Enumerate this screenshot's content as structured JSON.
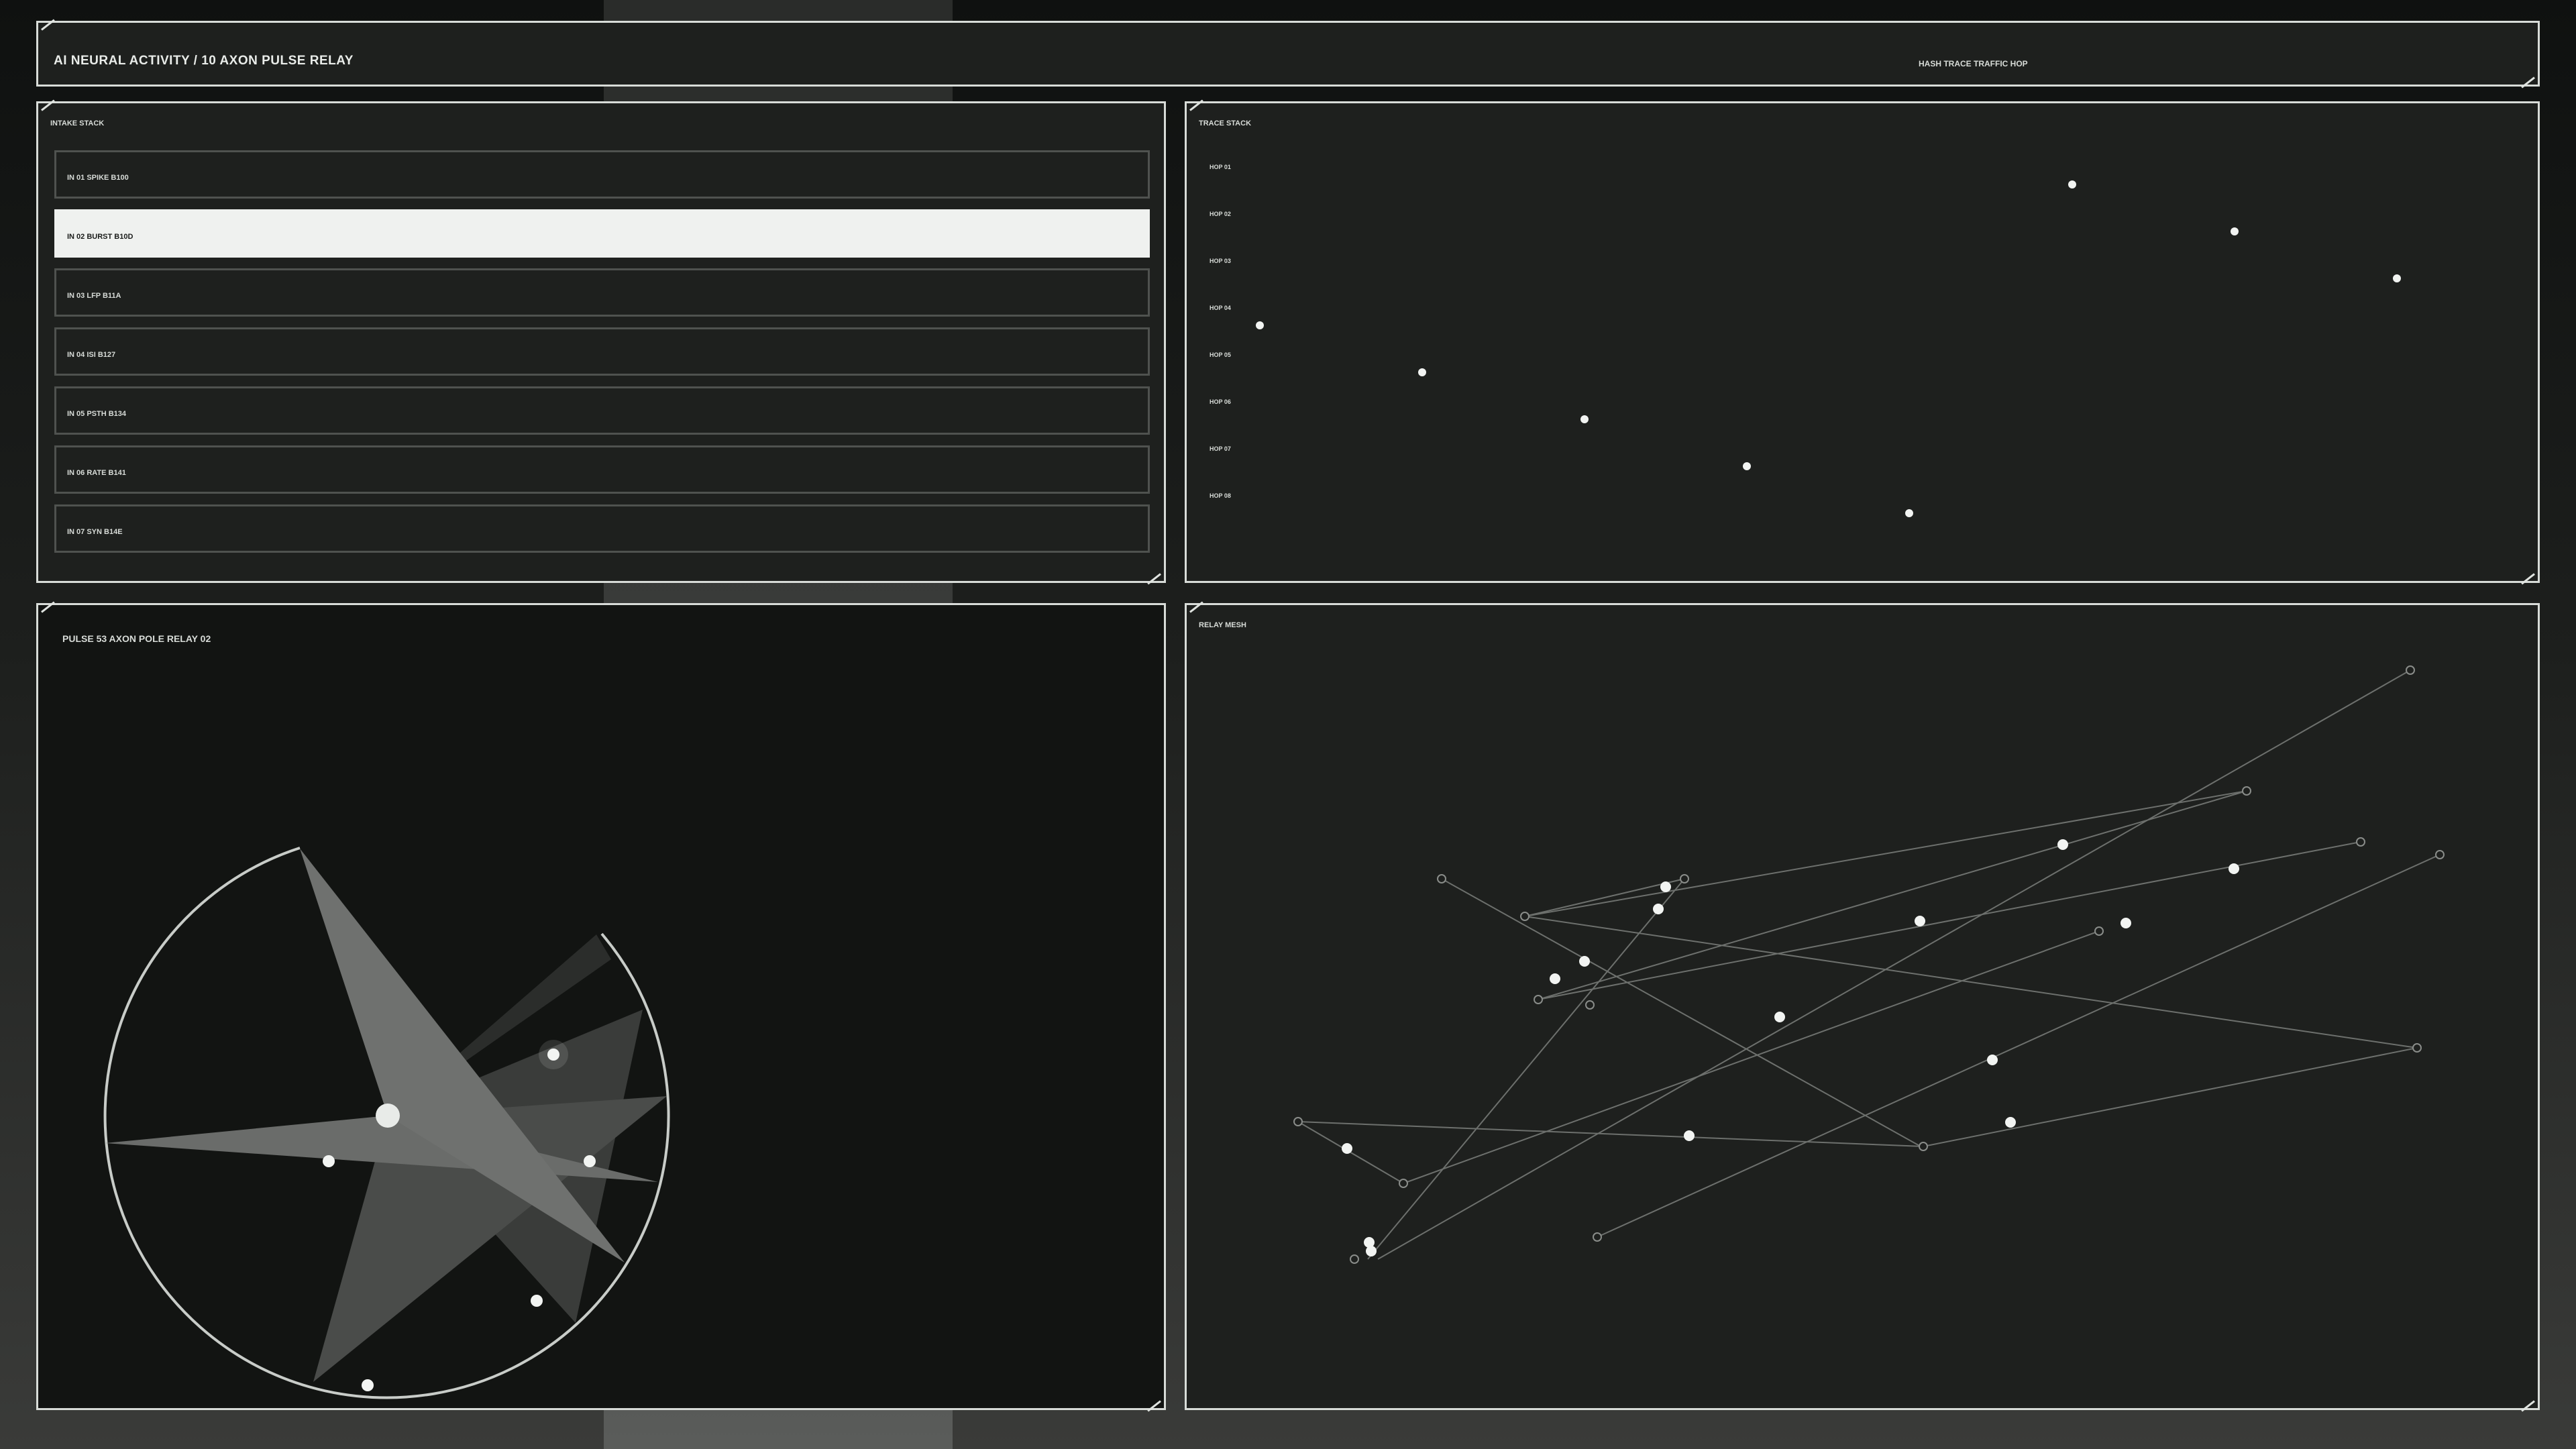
{
  "header": {
    "title": "AI NEURAL ACTIVITY  /  10  AXON PULSE RELAY",
    "right_labels": "HASH  TRACE  TRAFFIC  HOP"
  },
  "intake": {
    "title": "INTAKE STACK",
    "rows": [
      {
        "label": "IN 01  SPIKE  B100",
        "active": false
      },
      {
        "label": "IN 02  BURST  B10D",
        "active": true
      },
      {
        "label": "IN 03  LFP  B11A",
        "active": false
      },
      {
        "label": "IN 04  ISI  B127",
        "active": false
      },
      {
        "label": "IN 05  PSTH  B134",
        "active": false
      },
      {
        "label": "IN 06  RATE  B141",
        "active": false
      },
      {
        "label": "IN 07  SYN  B14E",
        "active": false
      }
    ]
  },
  "trace": {
    "title": "TRACE STACK",
    "hops": [
      "HOP 01",
      "HOP 02",
      "HOP 03",
      "HOP 04",
      "HOP 05",
      "HOP 06",
      "HOP 07",
      "HOP 08"
    ]
  },
  "pulse": {
    "title": "PULSE 53  AXON POLE  RELAY 02"
  },
  "relay": {
    "title": "RELAY MESH"
  },
  "colors": {
    "accent": "#eff1ef",
    "panel": "#1e201e",
    "border": "#d8dcd8"
  }
}
